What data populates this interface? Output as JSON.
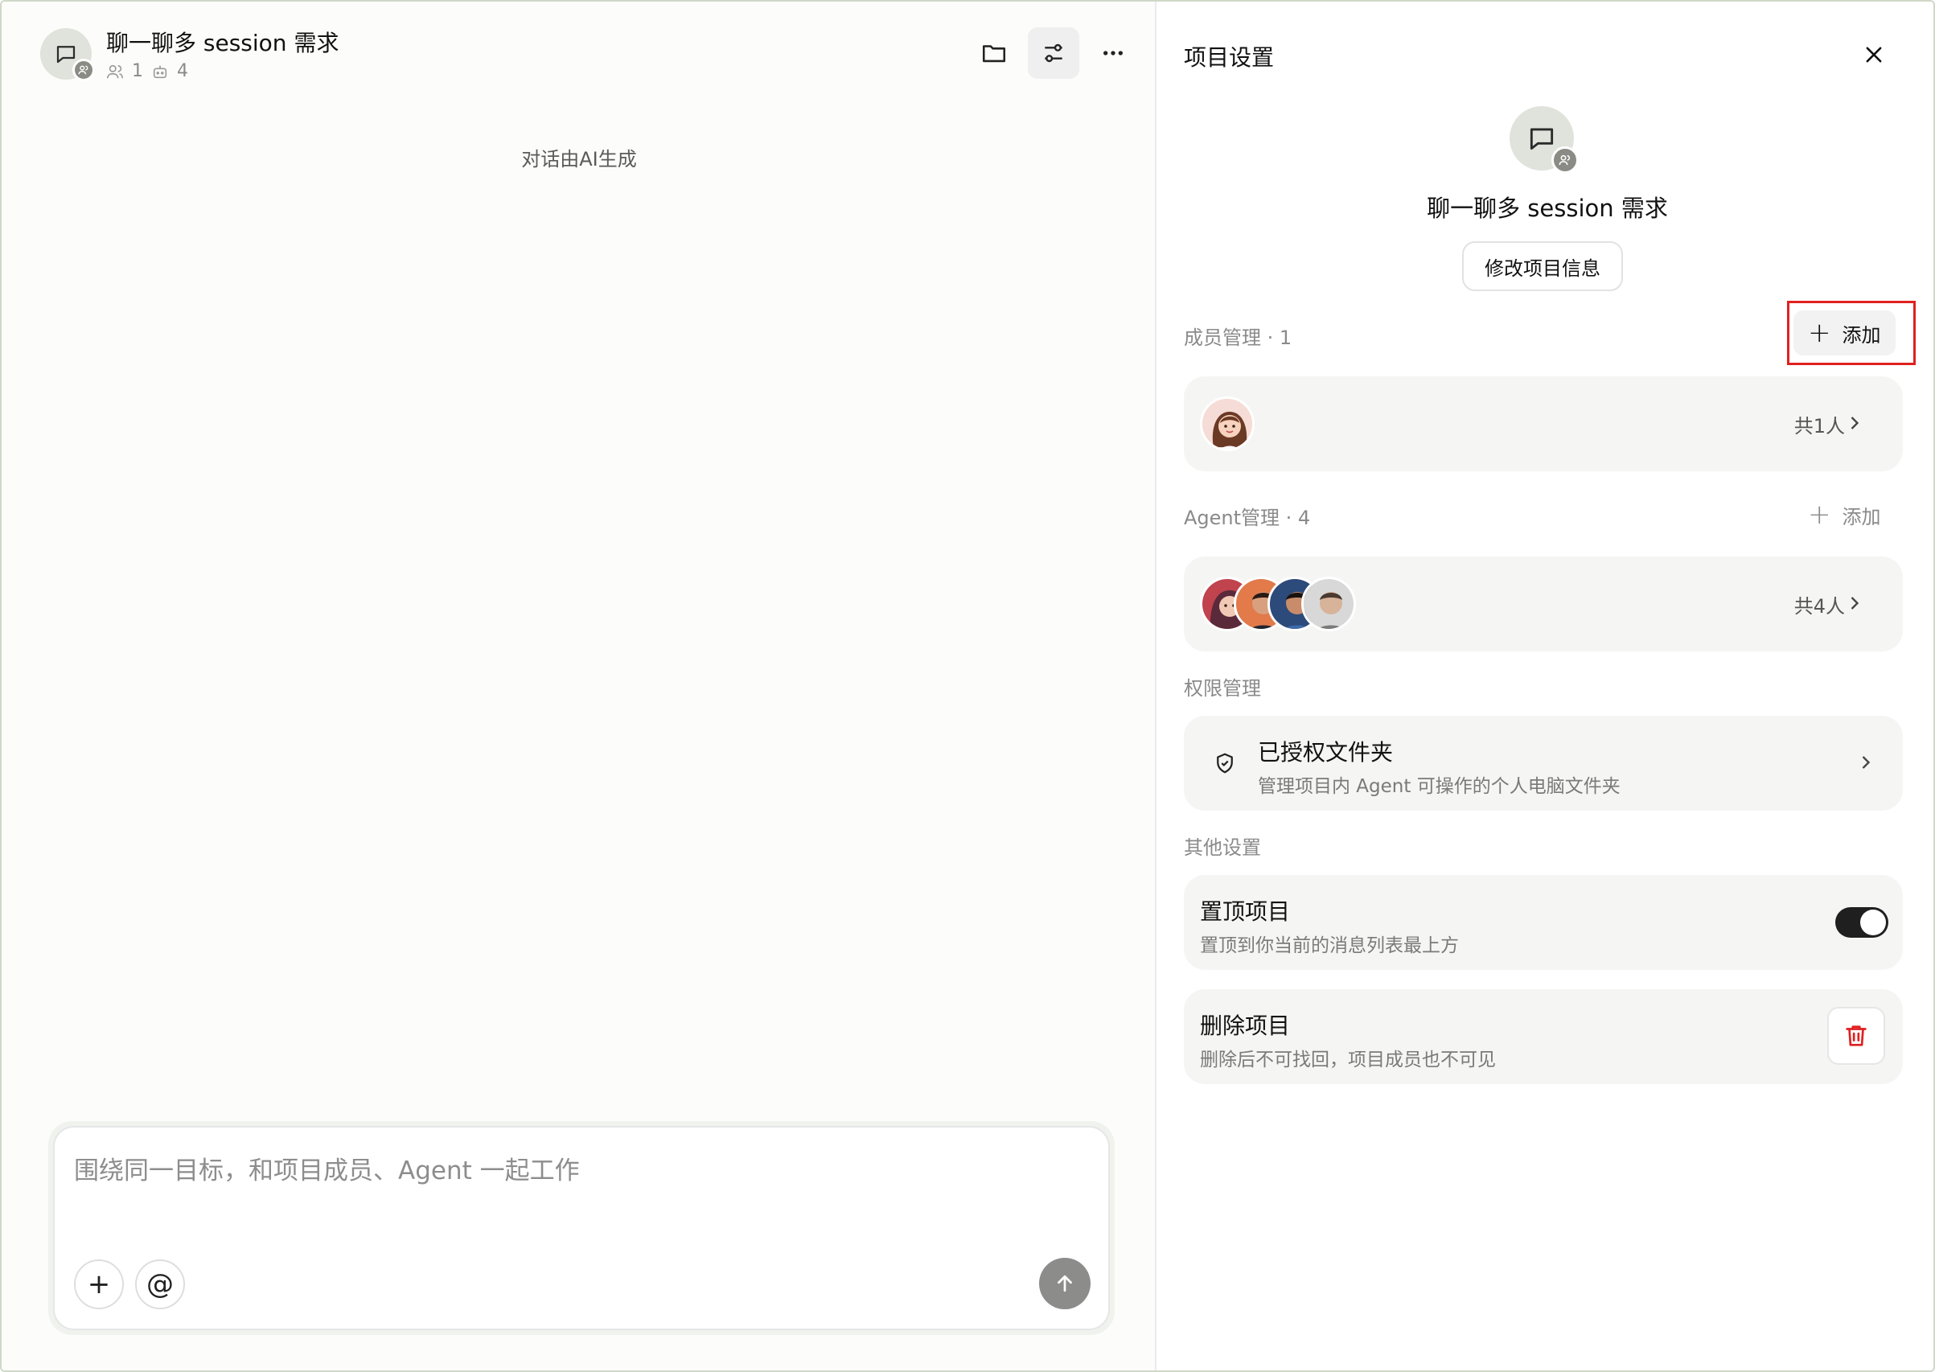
{
  "chat": {
    "title": "聊一聊多 session 需求",
    "member_count": "1",
    "agent_count": "4",
    "ai_note": "对话由AI生成",
    "composer_placeholder": "围绕同一目标，和项目成员、Agent 一起工作",
    "attach_label": "+",
    "mention_label": "@"
  },
  "panel": {
    "title": "项目设置",
    "project_name": "聊一聊多 session 需求",
    "edit_button": "修改项目信息",
    "members": {
      "section_label": "成员管理 · 1",
      "add_label": "添加",
      "total": "共1人"
    },
    "agents": {
      "section_label": "Agent管理 · 4",
      "add_label": "添加",
      "total": "共4人"
    },
    "permissions": {
      "section_label": "权限管理",
      "title": "已授权文件夹",
      "subtitle": "管理项目内 Agent 可操作的个人电脑文件夹"
    },
    "other": {
      "section_label": "其他设置",
      "pin_title": "置顶项目",
      "pin_subtitle": "置顶到你当前的消息列表最上方",
      "pin_enabled": true,
      "delete_title": "删除项目",
      "delete_subtitle": "删除后不可找回，项目成员也不可见"
    }
  },
  "colors": {
    "highlight": "#e02020",
    "delete_icon": "#e02020",
    "toggle_on": "#1f1f1f"
  }
}
